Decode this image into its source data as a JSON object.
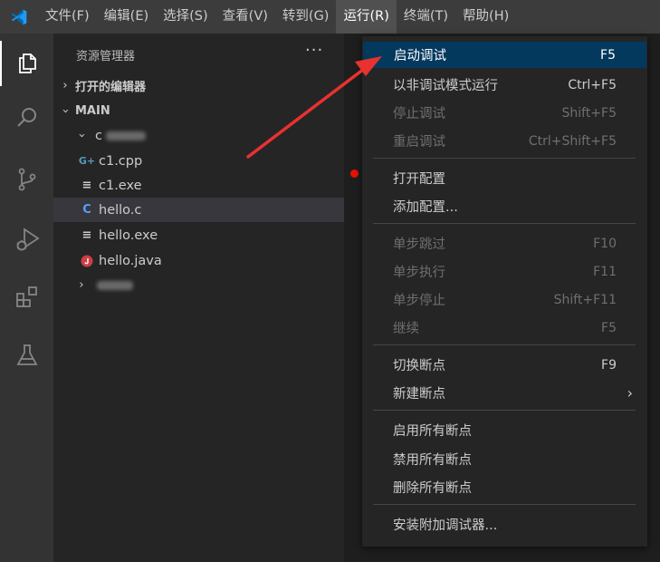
{
  "menubar": {
    "items": [
      {
        "label": "文件(F)"
      },
      {
        "label": "编辑(E)"
      },
      {
        "label": "选择(S)"
      },
      {
        "label": "查看(V)"
      },
      {
        "label": "转到(G)"
      },
      {
        "label": "运行(R)"
      },
      {
        "label": "终端(T)"
      },
      {
        "label": "帮助(H)"
      }
    ]
  },
  "sidebar": {
    "title": "资源管理器",
    "more": "···",
    "open_editors": "打开的编辑器",
    "workspace": "MAIN",
    "folder_prefix": "c",
    "files": [
      {
        "name": "c1.cpp",
        "icon": "G+",
        "icon_color": "#519aba"
      },
      {
        "name": "c1.exe",
        "icon": "≡",
        "icon_color": "#cccccc"
      },
      {
        "name": "hello.c",
        "icon": "C",
        "icon_color": "#599eff"
      },
      {
        "name": "hello.exe",
        "icon": "≡",
        "icon_color": "#cccccc"
      },
      {
        "name": "hello.java",
        "icon": "J",
        "icon_color": "#cc3e44"
      }
    ],
    "folder2_prefix": ""
  },
  "run_menu": {
    "items": [
      {
        "label": "启动调试",
        "shortcut": "F5",
        "state": "highlighted"
      },
      {
        "label": "以非调试模式运行",
        "shortcut": "Ctrl+F5",
        "state": "enabled"
      },
      {
        "label": "停止调试",
        "shortcut": "Shift+F5",
        "state": "disabled"
      },
      {
        "label": "重启调试",
        "shortcut": "Ctrl+Shift+F5",
        "state": "disabled"
      },
      {
        "label": "打开配置",
        "shortcut": "",
        "state": "enabled"
      },
      {
        "label": "添加配置...",
        "shortcut": "",
        "state": "enabled"
      },
      {
        "label": "单步跳过",
        "shortcut": "F10",
        "state": "disabled"
      },
      {
        "label": "单步执行",
        "shortcut": "F11",
        "state": "disabled"
      },
      {
        "label": "单步停止",
        "shortcut": "Shift+F11",
        "state": "disabled"
      },
      {
        "label": "继续",
        "shortcut": "F5",
        "state": "disabled"
      },
      {
        "label": "切换断点",
        "shortcut": "F9",
        "state": "enabled"
      },
      {
        "label": "新建断点",
        "shortcut": "",
        "state": "enabled",
        "submenu": true
      },
      {
        "label": "启用所有断点",
        "shortcut": "",
        "state": "enabled"
      },
      {
        "label": "禁用所有断点",
        "shortcut": "",
        "state": "enabled"
      },
      {
        "label": "删除所有断点",
        "shortcut": "",
        "state": "enabled"
      },
      {
        "label": "安装附加调试器...",
        "shortcut": "",
        "state": "enabled"
      }
    ]
  },
  "colors": {
    "menubar_bg": "#3c3c3c",
    "activitybar_bg": "#333333",
    "sidebar_bg": "#252526",
    "editor_bg": "#1e1e1e",
    "menu_highlight": "#04395e",
    "annotation_arrow": "#e8322f",
    "vscode_blue": "#0078d4"
  },
  "annotation": {
    "type": "red-arrow",
    "points_to": "启动调试"
  }
}
